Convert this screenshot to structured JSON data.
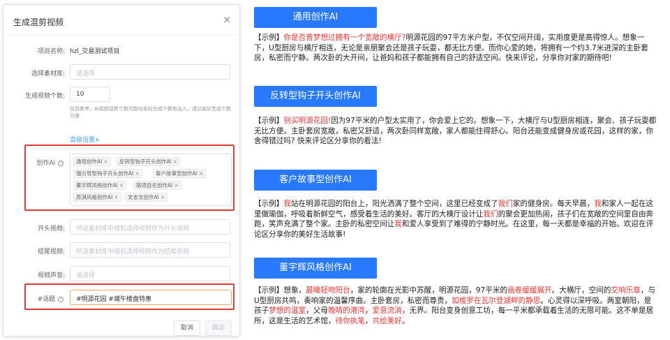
{
  "dialog": {
    "title": "生成混剪视频",
    "close_glyph": "×",
    "project_label": "项目名称:",
    "project_value": "hzl_交易测试项目",
    "material_label": "选择素材库:",
    "material_placeholder": "请选择",
    "count_label": "生成视频个数:",
    "count_value": "10",
    "count_hint": "仅供参考，AI视频混剪个数可能与实际生成个数有出入，请以实际生成个数为准",
    "advanced_label": "高级设置",
    "advanced_arrow": "∧",
    "ai_label": "创作AI",
    "ai_tags": [
      "通用创作AI",
      "反转型钩子开头创作AI",
      "强引导型钩子开头创作AI",
      "客户故事型创作AI",
      "董宇辉风格创作AI",
      "猜项目名创作AI",
      "房淇风格创作AI",
      "文言文创作AI"
    ],
    "tag_close": "×",
    "help_glyph": "?",
    "opening_label": "开头视频:",
    "opening_placeholder": "所选素材库中随机选择视频作为开头视频",
    "ending_label": "结尾视频:",
    "ending_placeholder": "所选素材库中随机选择视频作为结尾视频",
    "voice_label": "视频声音:",
    "voice_placeholder": "请选择",
    "topic_label": "#话题",
    "topic_value": "#明源花园 #端午楼盘特惠",
    "cancel_label": "取消",
    "ok_label": "确定"
  },
  "examples": [
    {
      "header": "通用创作AI",
      "prefix": "【示例】",
      "highlight": "你是否曾梦想过拥有一个宽敞的横厅?",
      "body": "明源花园的97平方米户型，不仅空间开阔，实用度更是高得惊人。想象一下，U型厨房与横厅相连，无论是亲朋聚会还是孩子玩耍，都无比方便。而你心爱的她，将拥有一个约3.7米进深的主卧套房，私密而宁静。两次卧的大开间，让爸妈和孩子都能拥有自己的舒适空间。快来评论，分享你对家的期待吧!"
    },
    {
      "header": "反转型钩子开头创作AI",
      "prefix": "【示例】",
      "highlight": "别买明源花园!",
      "body": "因为97平米的户型太实用了，你会爱上它的。想象一下，大横厅与U型厨房相连，聚会、孩子玩耍都无比方便。主卧套房宽敞，私密又舒适，两次卧同样宽敞，家人都能住得舒心。阳台还能变成健身房或花园，这样的家，你舍得错过吗? 快来评论区分享你的看法!"
    },
    {
      "header": "客户故事型创作AI",
      "parts": [
        {
          "t": "【示例】",
          "r": false
        },
        {
          "t": "我",
          "r": true
        },
        {
          "t": "站在明源花园的阳台上，阳光洒满了整个空间，这里已经变成了",
          "r": false
        },
        {
          "t": "我们",
          "r": true
        },
        {
          "t": "家的健身房。每天早晨，",
          "r": false
        },
        {
          "t": "我",
          "r": true
        },
        {
          "t": "和家人一起在这里做瑜伽，呼吸着新鲜空气，感受着生活的美好。客厅的大横厅设计让",
          "r": false
        },
        {
          "t": "我们",
          "r": true
        },
        {
          "t": "的聚会更加热闹，孩子们在宽敞的空间里自由奔跑，笑声充满了整个家。主卧的私密空间让",
          "r": false
        },
        {
          "t": "我",
          "r": true
        },
        {
          "t": "和爱人享受到了难得的宁静时光。在这里，每一天都是幸福的开始。欢迎在评论区分享你的美好生活故事!",
          "r": false
        }
      ]
    },
    {
      "header": "董宇辉风格创作AI",
      "parts": [
        {
          "t": "【示例】想象，",
          "r": false
        },
        {
          "t": "晨曦轻吻阳台",
          "r": true
        },
        {
          "t": "，家的轮廓在光影中苏醒，明源花园，97平米的",
          "r": false
        },
        {
          "t": "画卷缓缓展开",
          "r": true
        },
        {
          "t": "。大横厅，空间的",
          "r": false
        },
        {
          "t": "交响乐章",
          "r": true
        },
        {
          "t": "，与U型厨房共鸣，奏响家的温馨序曲。主卧套房，私密而尊贵，",
          "r": false
        },
        {
          "t": "如梭罗在瓦尔登湖畔的静思",
          "r": true
        },
        {
          "t": "。心灵得以深呼吸。两室朝阳，是孩子",
          "r": false
        },
        {
          "t": "梦想的温室",
          "r": true
        },
        {
          "t": "，父母",
          "r": false
        },
        {
          "t": "晚晴的港湾",
          "r": true
        },
        {
          "t": "，",
          "r": false
        },
        {
          "t": "爱意流淌",
          "r": true
        },
        {
          "t": "，无界。阳台变身创意工坊，每一平米都承载着生活的无限可能。这不单是居所，这是生活的艺术馆，",
          "r": false
        },
        {
          "t": "待你执笔",
          "r": true
        },
        {
          "t": "，",
          "r": false
        },
        {
          "t": "共绘美好",
          "r": true
        },
        {
          "t": "。",
          "r": false
        }
      ]
    }
  ],
  "colors": {
    "accent": "#2979ff",
    "highlight": "#e53935",
    "link": "#409eff"
  }
}
